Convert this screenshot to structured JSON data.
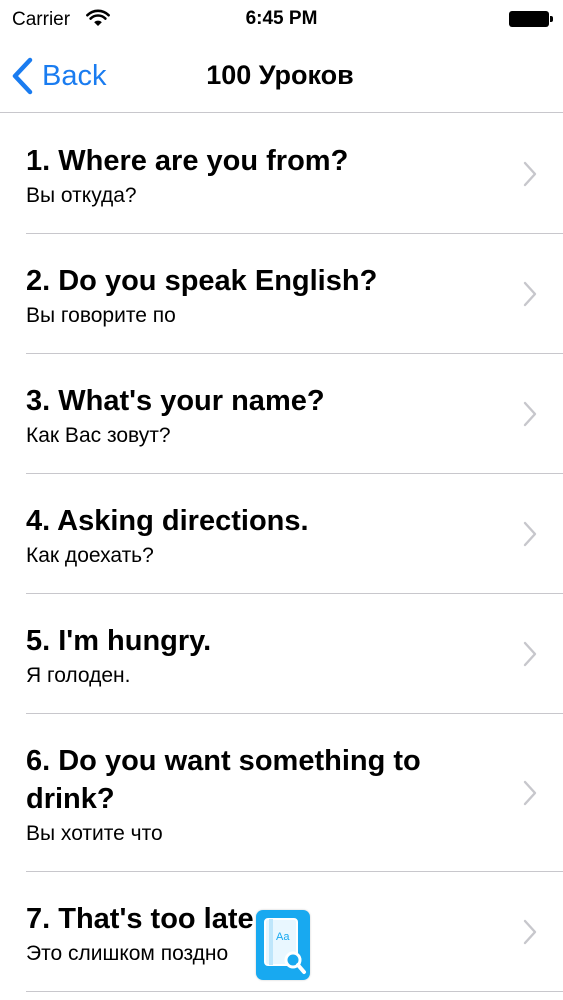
{
  "status_bar": {
    "carrier": "Carrier",
    "time": "6:45 PM",
    "wifi_icon": "wifi-icon",
    "battery_icon": "battery-icon"
  },
  "nav": {
    "back_label": "Back",
    "title": "100 Уроков",
    "accent_color": "#1a7cf0"
  },
  "lessons": [
    {
      "title": "1. Where are you from?",
      "subtitle": "Вы откуда?"
    },
    {
      "title": "2. Do you speak English?",
      "subtitle": "Вы говорите по"
    },
    {
      "title": "3. What's your name?",
      "subtitle": "Как Вас зовут?"
    },
    {
      "title": "4. Asking directions.",
      "subtitle": "Как доехать?"
    },
    {
      "title": "5. I'm hungry.",
      "subtitle": "Я голоден."
    },
    {
      "title": "6. Do you want something to drink?",
      "subtitle": "Вы хотите что"
    },
    {
      "title": "7. That's too late",
      "subtitle": "Это слишком поздно"
    }
  ],
  "dictionary_button": {
    "icon": "dictionary-search-icon",
    "icon_text": "Aa",
    "color": "#18a9f0"
  }
}
